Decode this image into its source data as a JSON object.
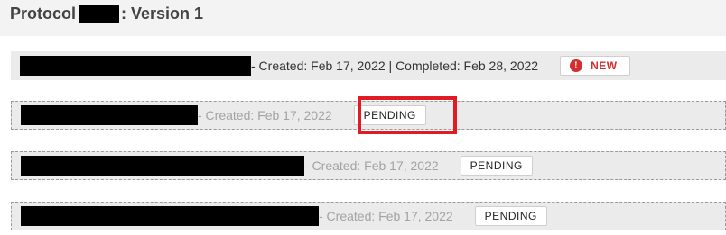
{
  "header": {
    "title_prefix": "Protocol",
    "title_suffix": ": Version 1"
  },
  "versions": [
    {
      "meta": "- Created: Feb 17, 2022 | Completed: Feb 28, 2022",
      "badge": "NEW",
      "badge_icon": "info-icon",
      "badge_color": "#d32f2f"
    },
    {
      "meta": "- Created: Feb 17, 2022",
      "badge": "PENDING"
    },
    {
      "meta": "- Created: Feb 17, 2022",
      "badge": "PENDING"
    },
    {
      "meta": "- Created: Feb 17, 2022",
      "badge": "PENDING"
    }
  ],
  "annotation": {
    "highlight_color": "#e01b24"
  }
}
